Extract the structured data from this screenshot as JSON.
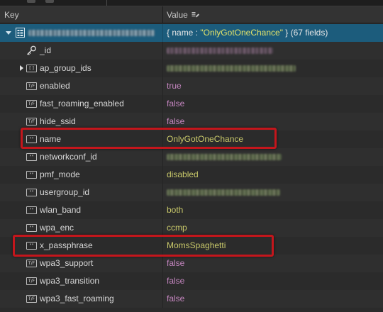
{
  "header": {
    "key_label": "Key",
    "value_label": "Value"
  },
  "root": {
    "value_prefix": "{ name : ",
    "value_name": "\"OnlyGotOneChance\"",
    "value_suffix": " } (67 fields)"
  },
  "rows": [
    {
      "key": "_id",
      "type": "objectid"
    },
    {
      "key": "ap_group_ids",
      "type": "array"
    },
    {
      "key": "enabled",
      "type": "bool",
      "value": "true"
    },
    {
      "key": "fast_roaming_enabled",
      "type": "bool",
      "value": "false"
    },
    {
      "key": "hide_ssid",
      "type": "bool",
      "value": "false"
    },
    {
      "key": "name",
      "type": "string",
      "value": "OnlyGotOneChance"
    },
    {
      "key": "networkconf_id",
      "type": "string"
    },
    {
      "key": "pmf_mode",
      "type": "string",
      "value": "disabled"
    },
    {
      "key": "usergroup_id",
      "type": "string"
    },
    {
      "key": "wlan_band",
      "type": "string",
      "value": "both"
    },
    {
      "key": "wpa_enc",
      "type": "string",
      "value": "ccmp"
    },
    {
      "key": "x_passphrase",
      "type": "string",
      "value": "MomsSpaghetti"
    },
    {
      "key": "wpa3_support",
      "type": "bool",
      "value": "false"
    },
    {
      "key": "wpa3_transition",
      "type": "bool",
      "value": "false"
    },
    {
      "key": "wpa3_fast_roaming",
      "type": "bool",
      "value": "false"
    }
  ],
  "icons": {
    "string": "\"\"",
    "bool": "T/F",
    "array": "[ ]"
  },
  "colors": {
    "selected_row": "#1c5c7c",
    "string_value": "#c9c96a",
    "bool_value": "#c586c0",
    "annotation": "#c4161c"
  }
}
